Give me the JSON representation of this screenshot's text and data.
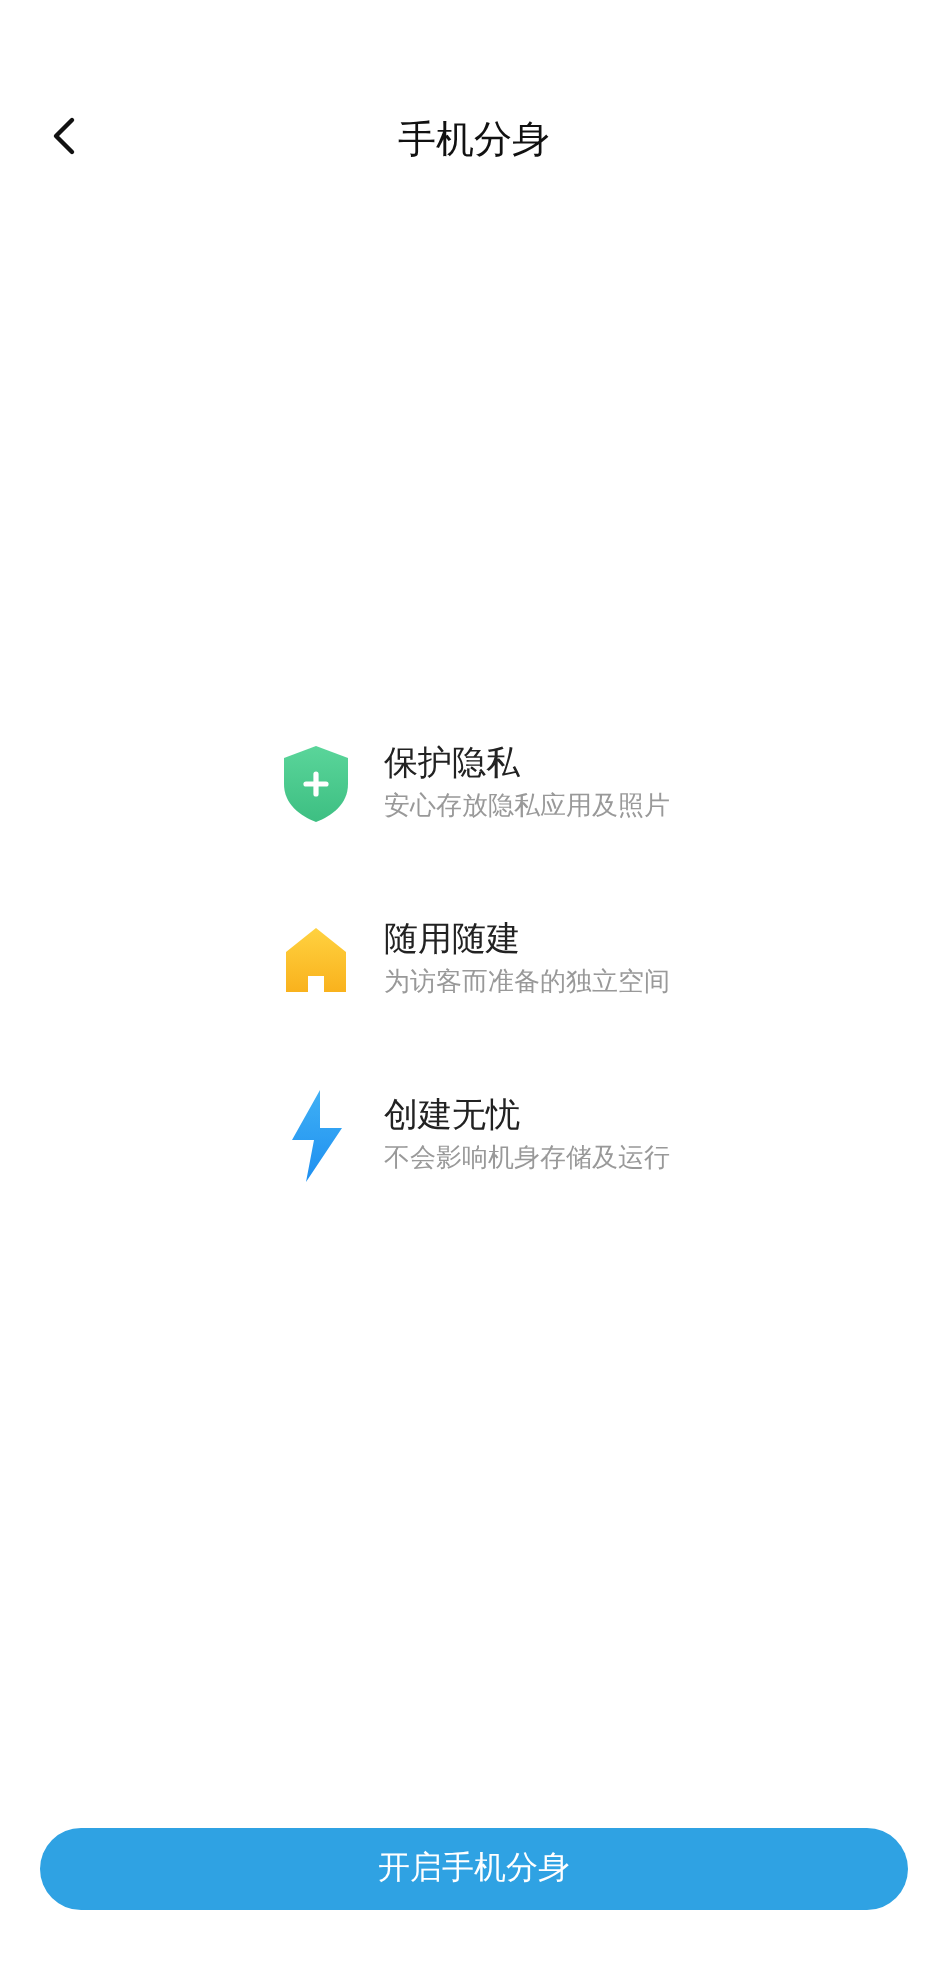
{
  "header": {
    "title": "手机分身"
  },
  "features": [
    {
      "kind": "shield",
      "title": "保护隐私",
      "subtitle": "安心存放隐私应用及照片"
    },
    {
      "kind": "house",
      "title": "随用随建",
      "subtitle": "为访客而准备的独立空间"
    },
    {
      "kind": "bolt",
      "title": "创建无忧",
      "subtitle": "不会影响机身存储及运行"
    }
  ],
  "primary_button": {
    "label": "开启手机分身"
  }
}
